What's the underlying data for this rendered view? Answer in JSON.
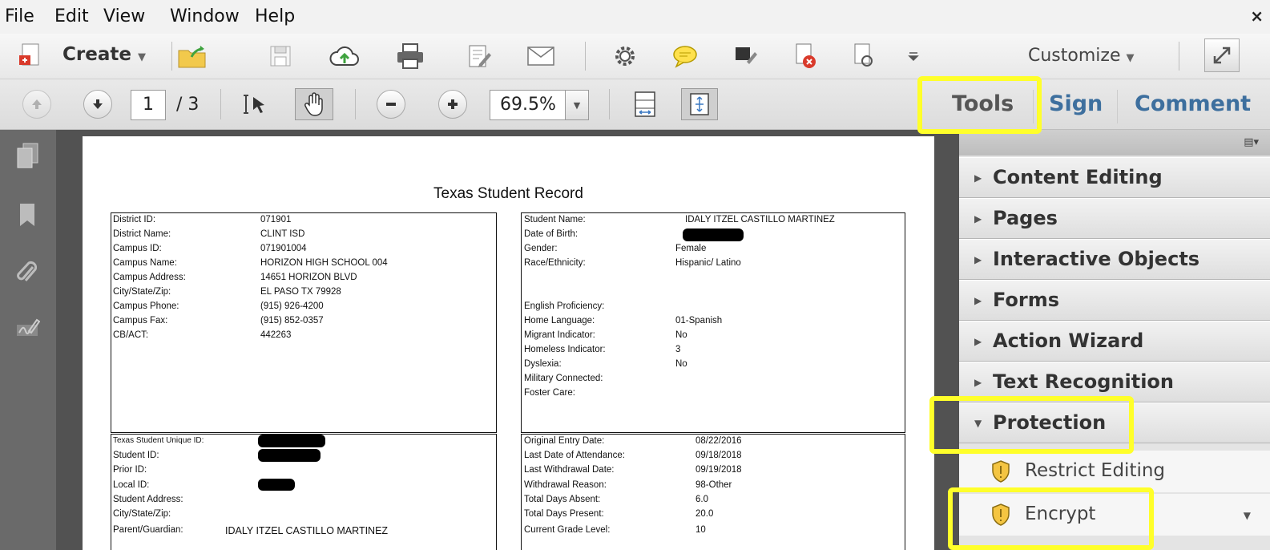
{
  "menu": {
    "items": [
      "File",
      "Edit",
      "View",
      "Window",
      "Help"
    ],
    "close": "×"
  },
  "toolbar": {
    "create_label": "Create",
    "customize_label": "Customize",
    "icons": [
      "create-icon",
      "open-folder-icon",
      "save-icon",
      "cloud-upload-icon",
      "print-icon",
      "edit-document-icon",
      "email-icon",
      "settings-icon",
      "comment-icon",
      "stamp-icon",
      "delete-pdf-icon",
      "attach-icon",
      "more-icon",
      "expand-icon"
    ]
  },
  "nav": {
    "current_page": "1",
    "total_pages": "/ 3",
    "zoom": "69.5%"
  },
  "pane_tabs": {
    "tools": "Tools",
    "sign": "Sign",
    "comment": "Comment"
  },
  "document": {
    "title": "Texas Student Record",
    "campus_block": [
      [
        "District ID:",
        "071901"
      ],
      [
        "District Name:",
        "CLINT ISD"
      ],
      [
        "Campus ID:",
        "071901004"
      ],
      [
        "Campus Name:",
        "HORIZON HIGH SCHOOL 004"
      ],
      [
        "Campus Address:",
        "14651 HORIZON BLVD"
      ],
      [
        "City/State/Zip:",
        "EL PASO TX 79928"
      ],
      [
        "Campus Phone:",
        "(915) 926-4200"
      ],
      [
        "Campus Fax:",
        "(915) 852-0357"
      ],
      [
        "CB/ACT:",
        "442263"
      ]
    ],
    "student_block": [
      [
        "Student Name:",
        "IDALY ITZEL CASTILLO MARTINEZ"
      ],
      [
        "Date of Birth:",
        ""
      ],
      [
        "Gender:",
        "Female"
      ],
      [
        "Race/Ethnicity:",
        "Hispanic/ Latino"
      ],
      [
        "English Proficiency:",
        ""
      ],
      [
        "Home Language:",
        "01-Spanish"
      ],
      [
        "Migrant Indicator:",
        "No"
      ],
      [
        "Homeless Indicator:",
        "3"
      ],
      [
        "Dyslexia:",
        "No"
      ],
      [
        "Military Connected:",
        ""
      ],
      [
        "Foster Care:",
        ""
      ]
    ],
    "id_block": [
      [
        "Texas Student Unique ID:",
        ""
      ],
      [
        "Student ID:",
        ""
      ],
      [
        "Prior ID:",
        ""
      ],
      [
        "Local ID:",
        ""
      ],
      [
        "Student Address:",
        ""
      ],
      [
        "City/State/Zip:",
        ""
      ],
      [
        "Parent/Guardian:",
        "IDALY ITZEL CASTILLO MARTINEZ"
      ]
    ],
    "enroll_block": [
      [
        "Original Entry Date:",
        "08/22/2016"
      ],
      [
        "Last Date of Attendance:",
        "09/18/2018"
      ],
      [
        "Last Withdrawal Date:",
        "09/19/2018"
      ],
      [
        "Withdrawal Reason:",
        "98-Other"
      ],
      [
        "Total Days Absent:",
        "6.0"
      ],
      [
        "Total Days Present:",
        "20.0"
      ],
      [
        "Current Grade Level:",
        "10"
      ]
    ]
  },
  "tools_pane": {
    "panels": [
      "Content Editing",
      "Pages",
      "Interactive Objects",
      "Forms",
      "Action Wizard",
      "Text Recognition",
      "Protection"
    ],
    "protection_items": [
      "Restrict Editing",
      "Encrypt"
    ]
  },
  "colors": {
    "highlight": "#ffff2a",
    "tab_blue": "#3d6f9e",
    "redaction": "#000000"
  }
}
